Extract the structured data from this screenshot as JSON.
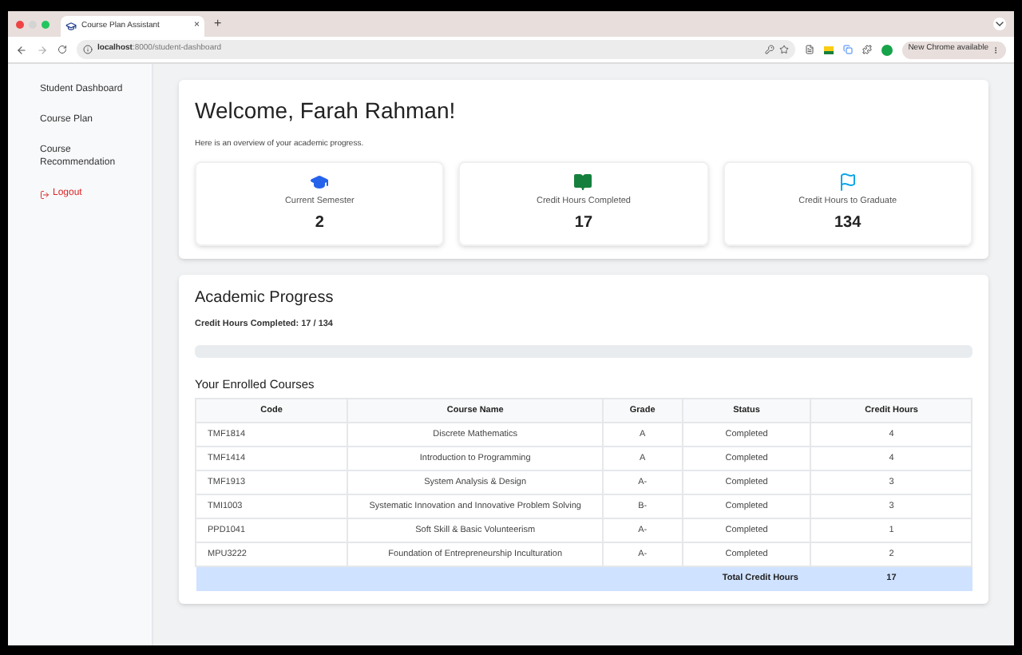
{
  "browser": {
    "tab_title": "Course Plan Assistant",
    "tab_close": "×",
    "new_tab": "+",
    "url_host": "localhost",
    "url_path": ":8000/student-dashboard",
    "update_button": "New Chrome available"
  },
  "sidebar": {
    "items": [
      {
        "label": "Student Dashboard",
        "kind": "link"
      },
      {
        "label": "Course Plan",
        "kind": "link"
      },
      {
        "label": "Course Recommendation",
        "kind": "link"
      },
      {
        "label": "Logout",
        "kind": "logout"
      }
    ]
  },
  "welcome": {
    "title": "Welcome, Farah Rahman!",
    "subtitle": "Here is an overview of your academic progress.",
    "stats": [
      {
        "kind": "cap",
        "label": "Current Semester",
        "value": "2"
      },
      {
        "kind": "book",
        "label": "Credit Hours Completed",
        "value": "17"
      },
      {
        "kind": "flag",
        "label": "Credit Hours to Graduate",
        "value": "134"
      }
    ]
  },
  "progress": {
    "title": "Academic Progress",
    "summary": "Credit Hours Completed: 17 / 134"
  },
  "courses": {
    "title": "Your Enrolled Courses",
    "columns": [
      "Code",
      "Course Name",
      "Grade",
      "Status",
      "Credit Hours"
    ],
    "rows": [
      [
        "TMF1814",
        "Discrete Mathematics",
        "A",
        "Completed",
        "4"
      ],
      [
        "TMF1414",
        "Introduction to Programming",
        "A",
        "Completed",
        "4"
      ],
      [
        "TMF1913",
        "System Analysis & Design",
        "A-",
        "Completed",
        "3"
      ],
      [
        "TMI1003",
        "Systematic Innovation and Innovative Problem Solving",
        "B-",
        "Completed",
        "3"
      ],
      [
        "PPD1041",
        "Soft Skill & Basic Volunteerism",
        "A-",
        "Completed",
        "1"
      ],
      [
        "MPU3222",
        "Foundation of Entrepreneurship Inculturation",
        "A-",
        "Completed",
        "2"
      ]
    ],
    "total_label": "Total Credit Hours",
    "total_value": "17"
  }
}
